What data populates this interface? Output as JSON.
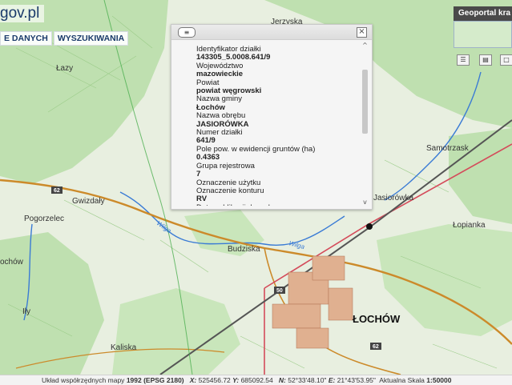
{
  "header": {
    "logo_text": "gov.pl",
    "buttons": [
      "E DANYCH",
      "WYSZUKIWANIA"
    ],
    "badge": "Geoportal kra"
  },
  "popup": {
    "fields": [
      {
        "label": "Identyfikator działki",
        "value": "143305_5.0008.641/9"
      },
      {
        "label": "Województwo",
        "value": "mazowieckie"
      },
      {
        "label": "Powiat",
        "value": "powiat węgrowski"
      },
      {
        "label": "Nazwa gminy",
        "value": "Łochów"
      },
      {
        "label": "Nazwa obrębu",
        "value": "JASIORÓWKA"
      },
      {
        "label": "Numer działki",
        "value": "641/9"
      },
      {
        "label": "Pole pow. w ewidencji gruntów (ha)",
        "value": "0.4363"
      },
      {
        "label": "Grupa rejestrowa",
        "value": "7"
      },
      {
        "label": "Oznaczenie użytku",
        "value": ""
      },
      {
        "label": "Oznaczenie konturu",
        "value": "RV"
      },
      {
        "label": "Data publikacji danych",
        "value": ""
      }
    ]
  },
  "map_labels": {
    "lazy": "Łazy",
    "gwizdaly": "Gwizdały",
    "pogorzelec": "Pogorzelec",
    "ochow_left": "ochów",
    "ily": "Iły",
    "kaliska": "Kaliska",
    "budziska": "Budziska",
    "lochow": "ŁOCHÓW",
    "jasiorowka": "Jasiorówka",
    "samotrzask": "Samotrzask",
    "lopianka": "Łopianka",
    "jerzyska": "Jerzyska",
    "wilga_left": "Wilga",
    "wilga_mid": "Wilga",
    "road_62_left": "62",
    "road_62_right": "62",
    "road_50": "50"
  },
  "status_bar": {
    "system_label": "Układ współrzędnych mapy",
    "system_value": "1992 (EPSG 2180)",
    "x_label": "X:",
    "x_value": "525456.72",
    "y_label": "Y:",
    "y_value": "685092.54",
    "n_label": "N:",
    "n_value": "52°33'48.10\"",
    "e_label": "E:",
    "e_value": "21°43'53.95\"",
    "scale_label": "Aktualna Skala",
    "scale_value": "1:50000"
  },
  "colors": {
    "forest": "#bfe0b0",
    "meadow": "#e8efe0",
    "water": "#3a7bd5",
    "main_road": "#cc8a2a",
    "railway": "#555555",
    "red_road": "#d44b5a"
  }
}
